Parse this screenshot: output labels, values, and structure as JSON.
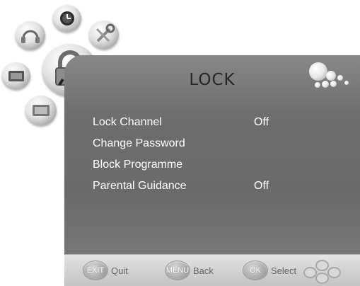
{
  "screen": {
    "title": "LOCK"
  },
  "menu": {
    "items": [
      {
        "label": "Lock Channel",
        "value": "Off"
      },
      {
        "label": "Change Password",
        "value": ""
      },
      {
        "label": "Block Programme",
        "value": ""
      },
      {
        "label": "Parental Guidance",
        "value": "Off"
      }
    ]
  },
  "footer": {
    "exit": {
      "key": "EXIT",
      "action": "Quit"
    },
    "menu": {
      "key": "MENU",
      "action": "Back"
    },
    "ok": {
      "key": "OK",
      "action": "Select"
    }
  },
  "side_icons": [
    "audio-icon",
    "clock-icon",
    "setup-icon",
    "lock-icon",
    "picture-icon",
    "channel-icon"
  ],
  "colors": {
    "panel": "#707070",
    "text": "#ffffff",
    "title": "#262626",
    "footer": "#d4d4d4"
  }
}
